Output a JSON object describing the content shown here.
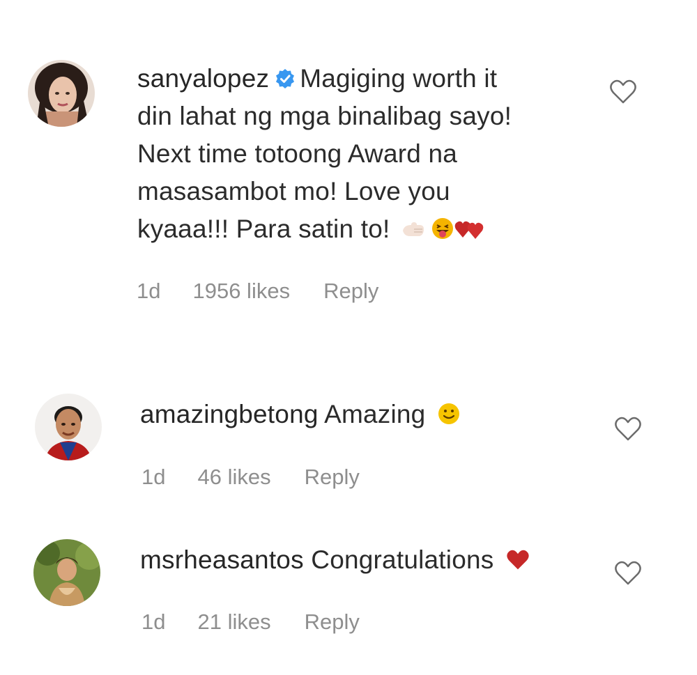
{
  "comments": [
    {
      "username": "sanyalopez",
      "verified": true,
      "text_lines": [
        "Magiging worth it",
        "din lahat ng mga binalibag sayo!",
        "Next time totoong Award na",
        "masasambot mo! Love you",
        "kyaaa!!! Para satin to!"
      ],
      "emojis": [
        "fist-icon",
        "tongue-out-face-icon",
        "two-hearts-icon"
      ],
      "time": "1d",
      "likes": "1956 likes",
      "reply_label": "Reply"
    },
    {
      "username": "amazingbetong",
      "verified": false,
      "text": "Amazing",
      "emojis": [
        "smiley-face-icon"
      ],
      "time": "1d",
      "likes": "46 likes",
      "reply_label": "Reply"
    },
    {
      "username": "msrheasantos",
      "verified": false,
      "text": "Congratulations",
      "emojis": [
        "red-heart-icon"
      ],
      "time": "1d",
      "likes": "21 likes",
      "reply_label": "Reply"
    }
  ],
  "colors": {
    "text": "#262626",
    "meta": "#8e8e8e",
    "verified_blue": "#3897f0",
    "heart_red": "#d32f2f"
  }
}
